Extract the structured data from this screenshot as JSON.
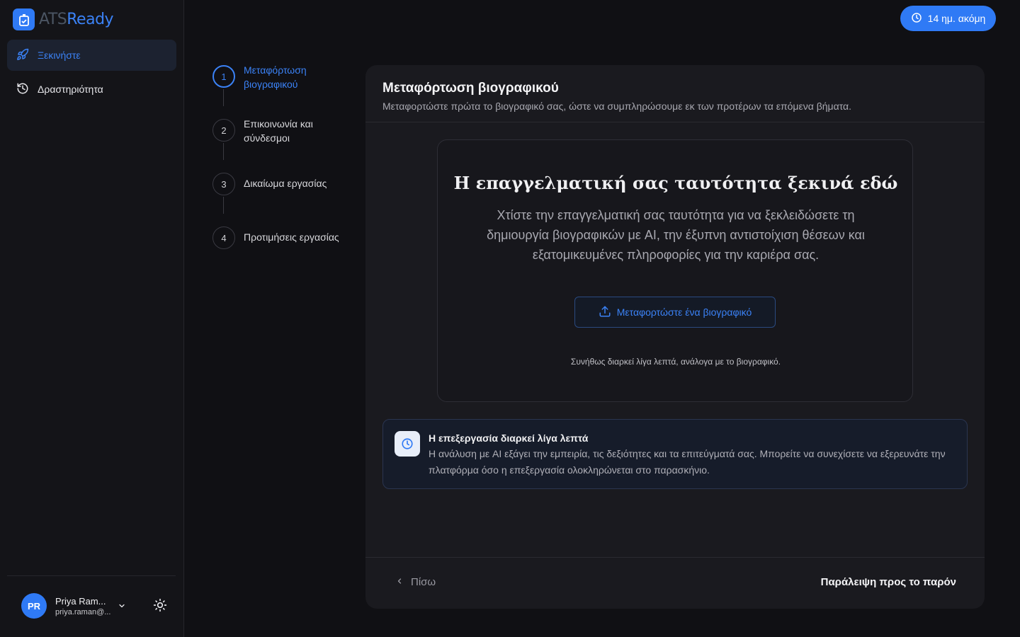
{
  "logo": {
    "part1": "ATS",
    "part2": "Ready"
  },
  "sidebar": {
    "items": [
      {
        "label": "Ξεκινήστε",
        "icon": "rocket-icon"
      },
      {
        "label": "Δραστηριότητα",
        "icon": "history-icon"
      }
    ]
  },
  "user": {
    "initials": "PR",
    "name": "Priya Ram...",
    "email": "priya.raman@..."
  },
  "trial": {
    "label": "14 ημ. ακόμη"
  },
  "steps": [
    {
      "number": "1",
      "label": "Μεταφόρτωση βιογραφικού"
    },
    {
      "number": "2",
      "label": "Επικοινωνία και σύνδεσμοι"
    },
    {
      "number": "3",
      "label": "Δικαίωμα εργασίας"
    },
    {
      "number": "4",
      "label": "Προτιμήσεις εργασίας"
    }
  ],
  "card": {
    "title": "Μεταφόρτωση βιογραφικού",
    "subtitle": "Μεταφορτώστε πρώτα το βιογραφικό σας, ώστε να συμπληρώσουμε εκ των προτέρων τα επόμενα βήματα.",
    "hero_title": "Η επαγγελματική σας ταυτότητα ξεκινά εδώ",
    "hero_desc": "Χτίστε την επαγγελματική σας ταυτότητα για να ξεκλειδώσετε τη δημιουργία βιογραφικών με AI, την έξυπνη αντιστοίχιση θέσεων και εξατομικευμένες πληροφορίες για την καριέρα σας.",
    "upload_label": "Μεταφορτώστε ένα βιογραφικό",
    "upload_note": "Συνήθως διαρκεί λίγα λεπτά, ανάλογα με το βιογραφικό.",
    "info_title": "Η επεξεργασία διαρκεί λίγα λεπτά",
    "info_text": "Η ανάλυση με AI εξάγει την εμπειρία, τις δεξιότητες και τα επιτεύγματά σας. Μπορείτε να συνεχίσετε να εξερευνάτε την πλατφόρμα όσο η επεξεργασία ολοκληρώνεται στο παρασκήνιο.",
    "back_label": "Πίσω",
    "skip_label": "Παράλειψη προς το παρόν"
  },
  "colors": {
    "accent": "#2f7af5",
    "background": "#101014"
  }
}
